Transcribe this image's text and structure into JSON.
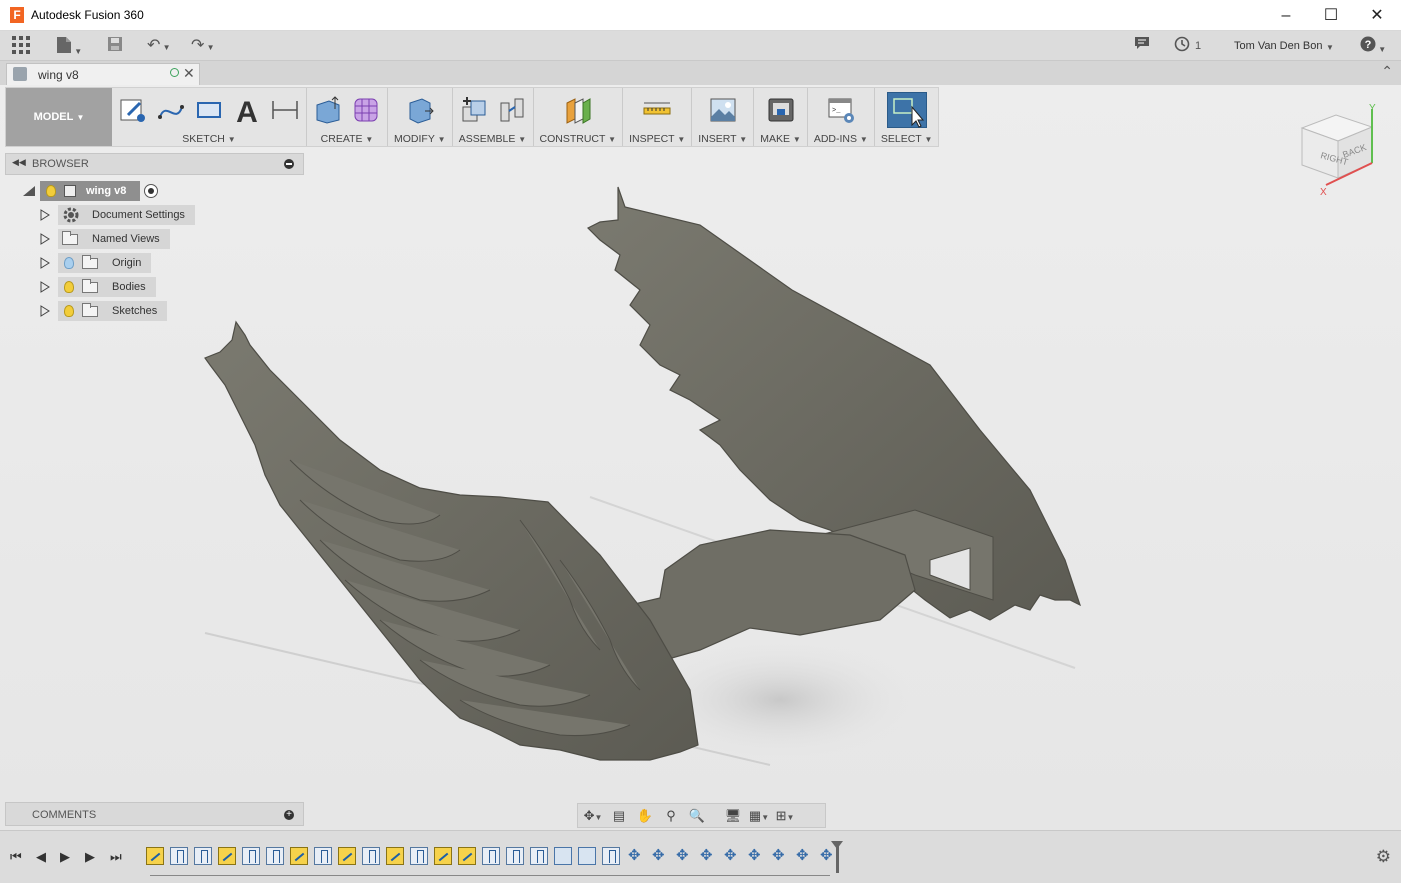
{
  "window": {
    "title": "Autodesk Fusion 360",
    "app_icon": "F"
  },
  "qab": {
    "job_count": "1",
    "user": "Tom Van Den Bon"
  },
  "document": {
    "tab_label": "wing v8"
  },
  "toolbar": {
    "workspace": "MODEL",
    "groups": [
      "SKETCH",
      "CREATE",
      "MODIFY",
      "ASSEMBLE",
      "CONSTRUCT",
      "INSPECT",
      "INSERT",
      "MAKE",
      "ADD-INS",
      "SELECT"
    ]
  },
  "browser": {
    "title": "BROWSER",
    "root": "wing v8",
    "items": [
      {
        "label": "Document Settings",
        "icon": "gear-icon"
      },
      {
        "label": "Named Views",
        "icon": "folder-icon"
      },
      {
        "label": "Origin",
        "icon": "folder-icon",
        "visible": false
      },
      {
        "label": "Bodies",
        "icon": "folder-icon",
        "visible": true
      },
      {
        "label": "Sketches",
        "icon": "folder-icon",
        "visible": true
      }
    ]
  },
  "comments": {
    "title": "COMMENTS"
  },
  "viewcube": {
    "face_right": "RIGHT",
    "face_back": "BACK",
    "axis_x": "X",
    "axis_y": "Y"
  },
  "timeline": {
    "features": [
      "sketch",
      "extrude",
      "extrude",
      "sketch",
      "extrude",
      "extrude",
      "sketch",
      "extrude",
      "sketch",
      "extrude",
      "sketch",
      "extrude",
      "sketch",
      "sketch",
      "extrude",
      "extrude",
      "extrude",
      "box",
      "box",
      "extrude",
      "move",
      "move",
      "move",
      "move",
      "move",
      "move",
      "move",
      "move",
      "move"
    ]
  },
  "colors": {
    "workspace_bg": "#a2a2a2",
    "select_active": "#3d73a8",
    "model_body": "#6b6a60"
  }
}
